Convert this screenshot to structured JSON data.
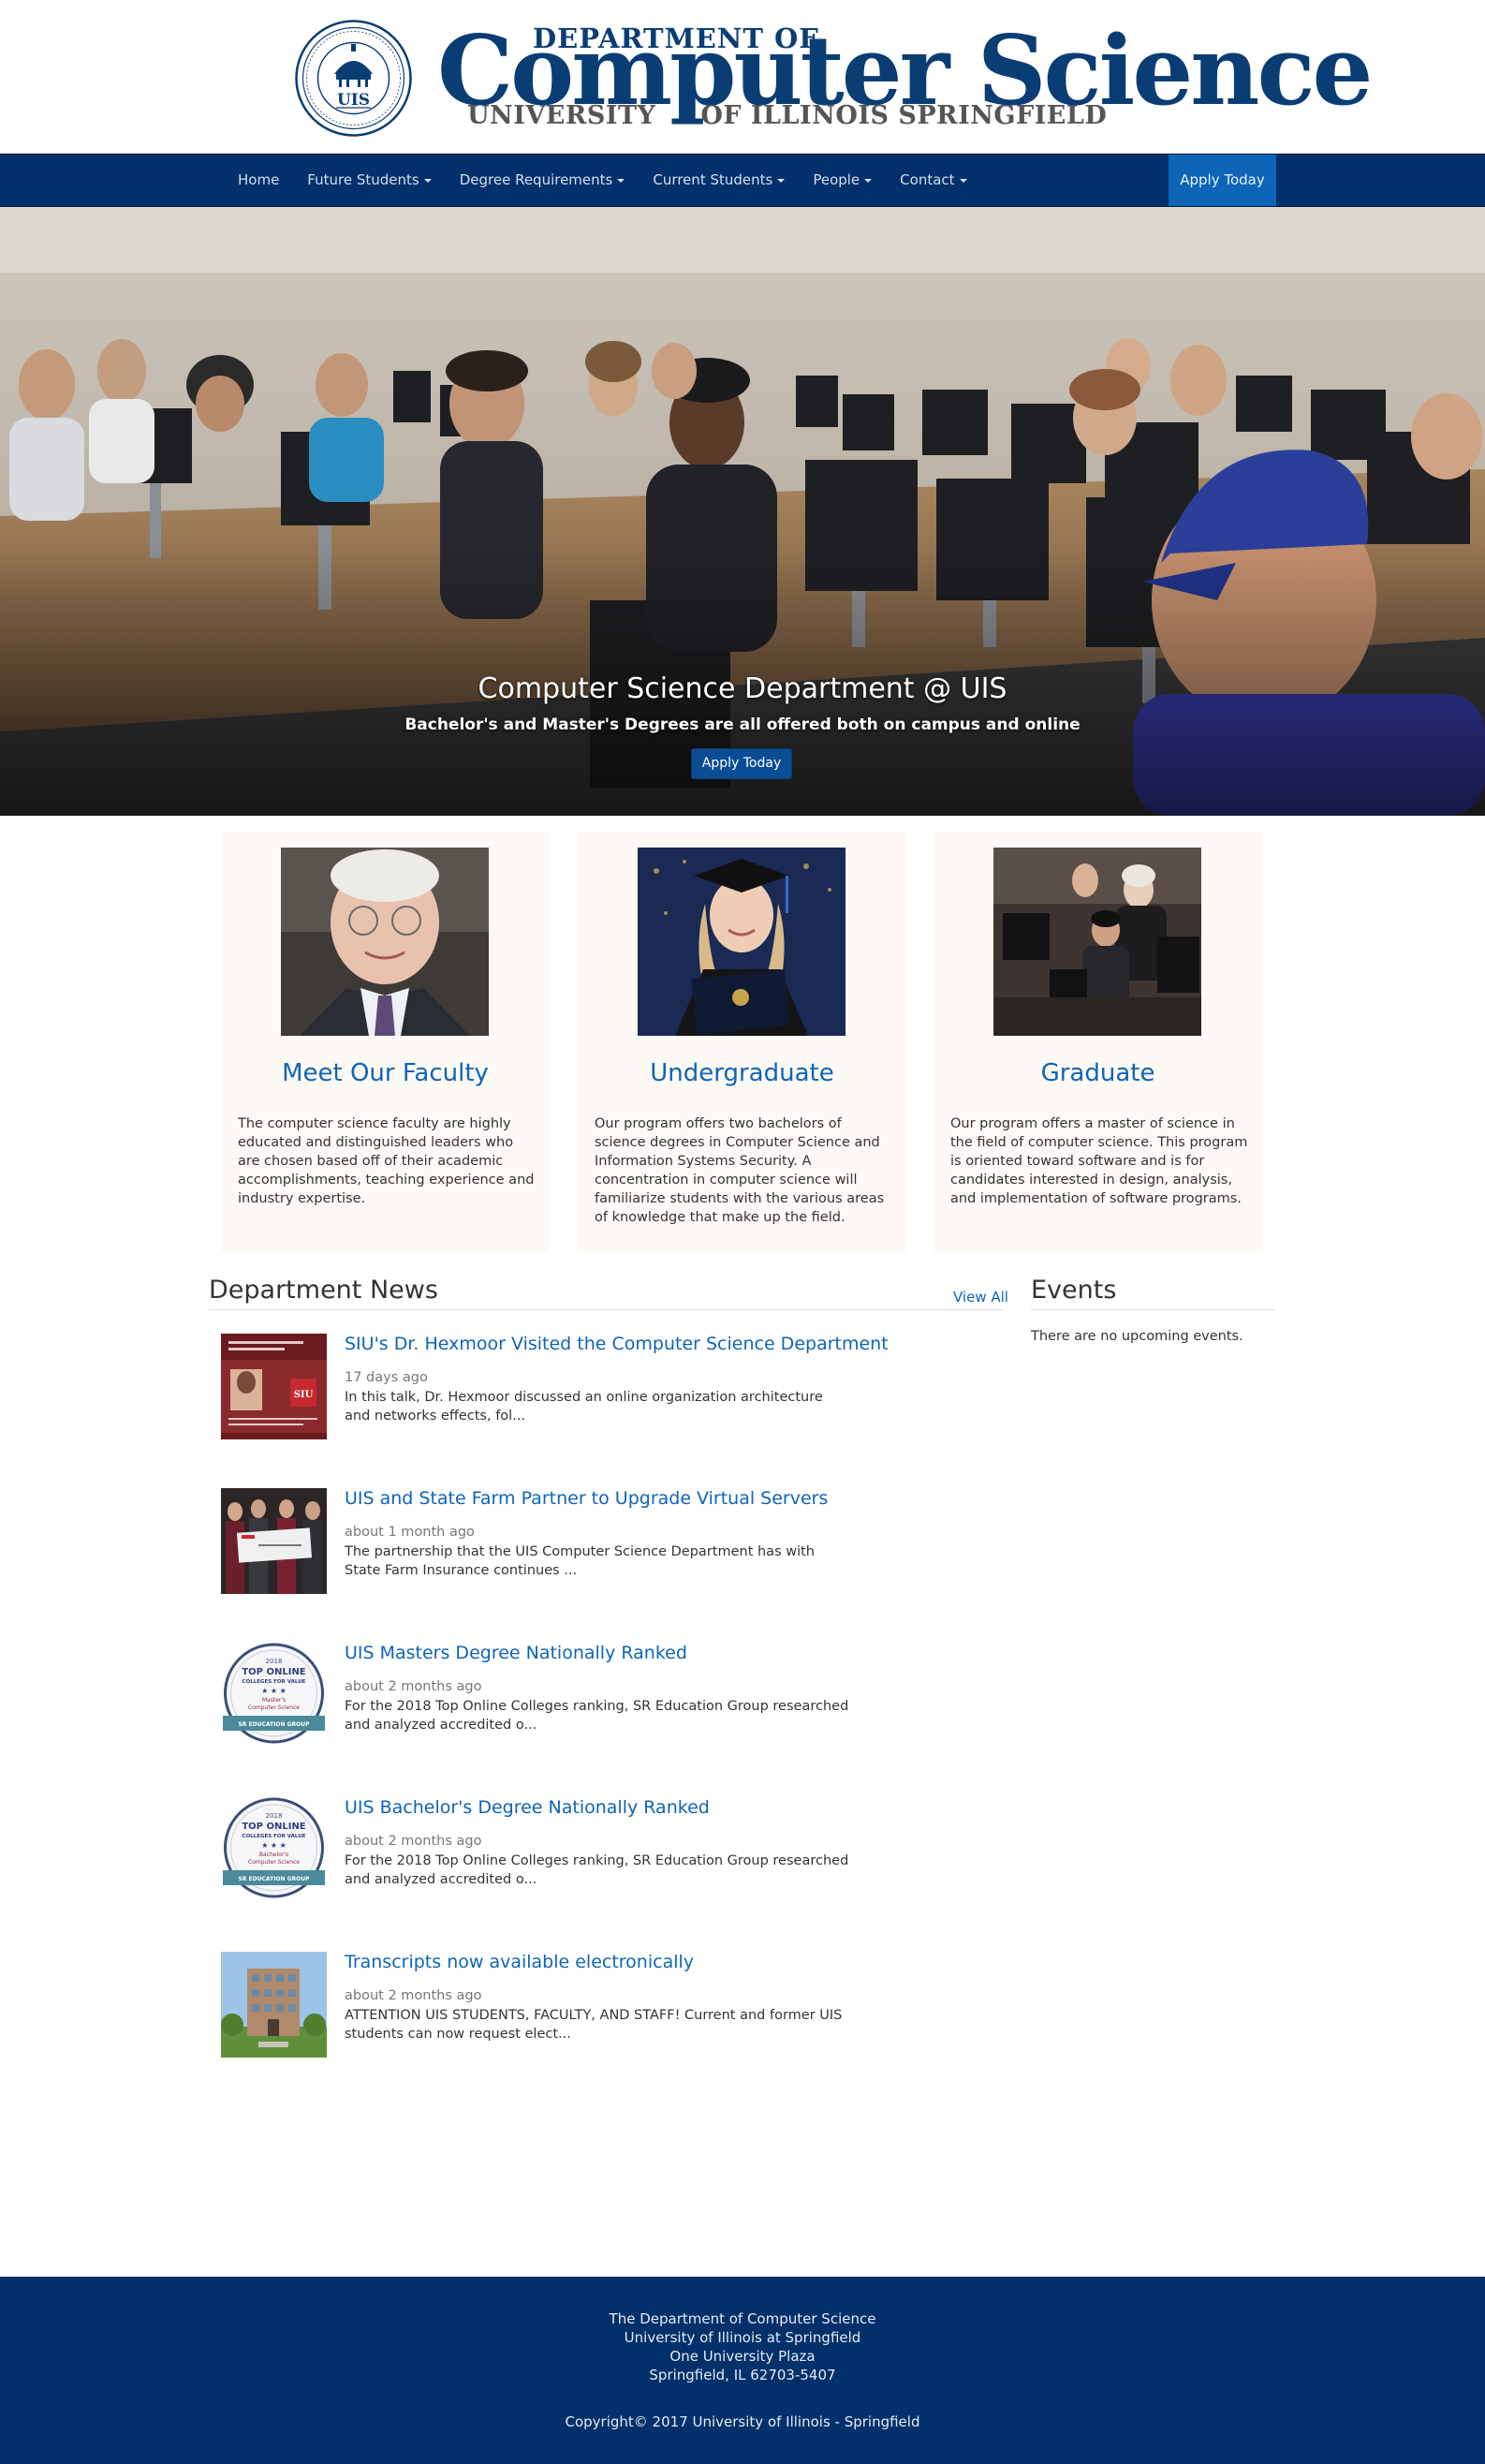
{
  "header": {
    "seal_text": "UIS",
    "dept_of": "DEPARTMENT OF",
    "title": "Computer Science",
    "univ_left": "UNIVERSITY",
    "univ_right": "OF ILLINOIS SPRINGFIELD"
  },
  "nav": {
    "items": [
      {
        "label": "Home",
        "dropdown": false
      },
      {
        "label": "Future Students",
        "dropdown": true
      },
      {
        "label": "Degree Requirements",
        "dropdown": true
      },
      {
        "label": "Current Students",
        "dropdown": true
      },
      {
        "label": "People",
        "dropdown": true
      },
      {
        "label": "Contact",
        "dropdown": true
      }
    ],
    "apply_label": "Apply Today"
  },
  "hero": {
    "title": "Computer Science Department @ UIS",
    "subtitle": "Bachelor's and Master's Degrees are all offered both on campus and online",
    "button_label": "Apply Today"
  },
  "cards": [
    {
      "title": "Meet Our Faculty",
      "text": "The computer science faculty are highly educated and distinguished leaders who are chosen based off of their academic accomplishments, teaching experience and industry expertise."
    },
    {
      "title": "Undergraduate",
      "text": "Our program offers two bachelors of science degrees in Computer Science and Information Systems Security. A concentration in computer science will familiarize students with the various areas of knowledge that make up the field."
    },
    {
      "title": "Graduate",
      "text": "Our program offers a master of science in the field of computer science. This program is oriented toward software and is for candidates interested in design, analysis, and implementation of software programs."
    }
  ],
  "news": {
    "heading": "Department News",
    "view_all": "View All",
    "items": [
      {
        "title": "SIU's Dr. Hexmoor Visited the Computer Science Department",
        "date": "17 days ago",
        "text": "In this talk, Dr. Hexmoor discussed an online organization architecture and networks effects, fol..."
      },
      {
        "title": "UIS and State Farm Partner to Upgrade Virtual Servers",
        "date": "about 1 month ago",
        "text": "The partnership that the UIS Computer Science Department has with State Farm Insurance continues ..."
      },
      {
        "title": "UIS Masters Degree Nationally Ranked",
        "date": "about 2 months ago",
        "text": "For the 2018 Top Online Colleges ranking, SR Education Group researched and analyzed accredited o..."
      },
      {
        "title": "UIS Bachelor's Degree Nationally Ranked",
        "date": "about 2 months ago",
        "text": "For the 2018 Top Online Colleges ranking, SR Education Group researched and analyzed accredited o..."
      },
      {
        "title": "Transcripts now available electronically",
        "date": "about 2 months ago",
        "text": "ATTENTION UIS STUDENTS, FACULTY, AND STAFF! Current and former UIS students can now request elect..."
      }
    ],
    "badges": {
      "year": "2018",
      "line1": "TOP ONLINE",
      "line2": "COLLEGES FOR VALUE",
      "masters": "Master's",
      "bachelors": "Bachelor's",
      "program": "Computer Science",
      "ribbon": "SR EDUCATION GROUP"
    },
    "hexmoor_badge": "SIU"
  },
  "events": {
    "heading": "Events",
    "empty_text": "There are no upcoming events."
  },
  "footer": {
    "lines": [
      "The Department of Computer Science",
      "University of Illinois at Springfield",
      "One University Plaza",
      "Springfield, IL 62703-5407"
    ],
    "copyright": "Copyright© 2017 University of Illinois - Springfield"
  },
  "colors": {
    "brand_navy": "#01306a",
    "link_blue": "#0e64b7",
    "card_bg": "#fdf9f5"
  }
}
